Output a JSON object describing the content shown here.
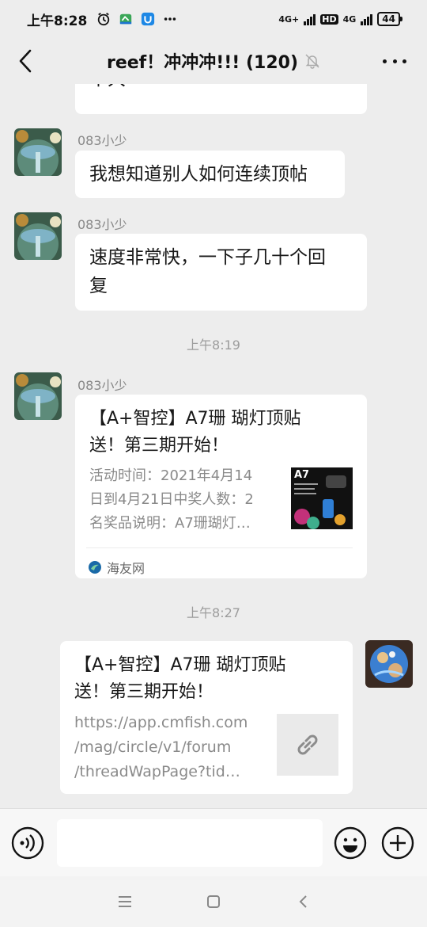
{
  "status_bar": {
    "time": "上午8:28",
    "network_1": "4G+",
    "hd": "HD",
    "network_2": "4G",
    "battery": "44"
  },
  "header": {
    "title": "reef！冲冲冲!!! (120)",
    "icons": [
      "back-icon",
      "mute-bell-icon",
      "more-icon"
    ]
  },
  "messages": [
    {
      "type": "text-partial",
      "text": "不大"
    },
    {
      "type": "text",
      "sender": "083小少",
      "text": "我想知道别人如何连续顶帖"
    },
    {
      "type": "text",
      "sender": "083小少",
      "text_line1": "速度非常快，一下子几十个回",
      "text_line2": "复"
    },
    {
      "type": "timestamp",
      "text": "上午8:19"
    },
    {
      "type": "card",
      "sender": "083小少",
      "title_line1": "【A+智控】A7珊 瑚灯顶贴",
      "title_line2": "送！第三期开始！",
      "desc_line1": "活动时间：2021年4月14",
      "desc_line2": "日到4月21日中奖人数：2",
      "desc_line3": "名奖品说明：A7珊瑚灯…",
      "thumb_label": "A7",
      "source": "海友网"
    },
    {
      "type": "timestamp",
      "text": "上午8:27"
    },
    {
      "type": "link-card",
      "title_line1": "【A+智控】A7珊 瑚灯顶贴",
      "title_line2": "送！第三期开始！",
      "url_line1": "https://app.cmfish.com",
      "url_line2": "/mag/circle/v1/forum",
      "url_line3": "/threadWapPage?tid…"
    }
  ],
  "input": {
    "placeholder": "",
    "value": ""
  },
  "colors": {
    "background": "#ededed",
    "bubble": "#ffffff",
    "muted_text": "#8a8a8a"
  }
}
